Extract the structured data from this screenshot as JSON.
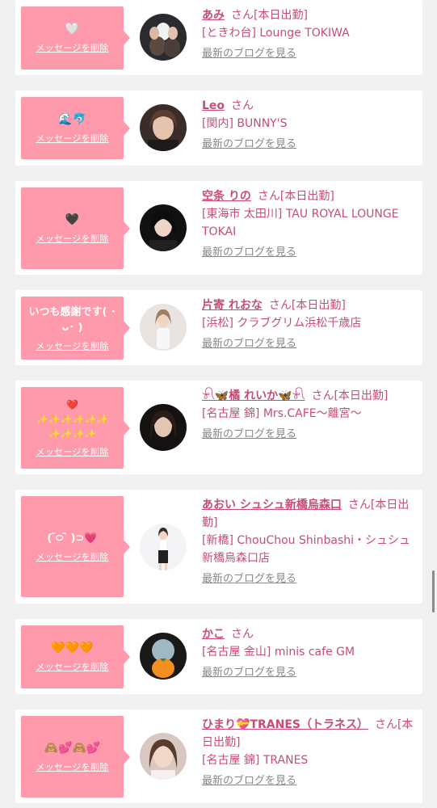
{
  "common": {
    "delete_label": "メッセージを削除",
    "san": "さん",
    "blog_label": "最新のブログを見る",
    "accent": "#fe9aab",
    "text_pink": "#c94b77"
  },
  "cards": [
    {
      "message": "🤍",
      "name": "あみ",
      "suffix": "さん[本日出勤]",
      "shop": "[ときわ台] Lounge TOKIWA",
      "avatar": "avatar-photo-1"
    },
    {
      "message": "🌊🐬",
      "name": "Leo",
      "suffix": "さん",
      "shop": "[関内] BUNNY'S",
      "avatar": "avatar-photo-2"
    },
    {
      "message": "🖤",
      "name": "空条 りの",
      "suffix": "さん[本日出勤]",
      "shop": "[東海市 太田川] TAU ROYAL LOUNGE TOKAI",
      "avatar": "avatar-photo-3"
    },
    {
      "message": "いつも感謝です( ･ᴗ･ )",
      "name": "片寄 れおな",
      "suffix": "さん[本日出勤]",
      "shop": "[浜松] クラブグリム浜松千歳店",
      "avatar": "avatar-photo-4"
    },
    {
      "message": "❤️\n✨✨✨✨✨✨\n✨✨✨✨",
      "name": "𓍯🦋橘 れいか🦋𓍯",
      "suffix": "さん[本日出勤]",
      "shop": "[名古屋 錦] Mrs.CAFE〜離宮〜",
      "avatar": "avatar-photo-5"
    },
    {
      "message": "( ᷇࿀ ᷆ )⊃💗",
      "name": "あおい シュシュ新橋烏森口",
      "suffix": "さん[本日出勤]",
      "shop": "[新橋] ChouChou Shinbashi・シュシュ新橋烏森口店",
      "avatar": "avatar-photo-6"
    },
    {
      "message": "🧡🧡🧡",
      "name": "かこ",
      "suffix": "さん",
      "shop": "[名古屋 金山] minis cafe GM",
      "avatar": "avatar-photo-7"
    },
    {
      "message": "🙈💕🙈💕",
      "name": "ひまり💝TRANES（トラネス）",
      "suffix": "さん[本日出勤]",
      "shop": "[名古屋 錦] TRANES",
      "avatar": "avatar-photo-8"
    }
  ]
}
